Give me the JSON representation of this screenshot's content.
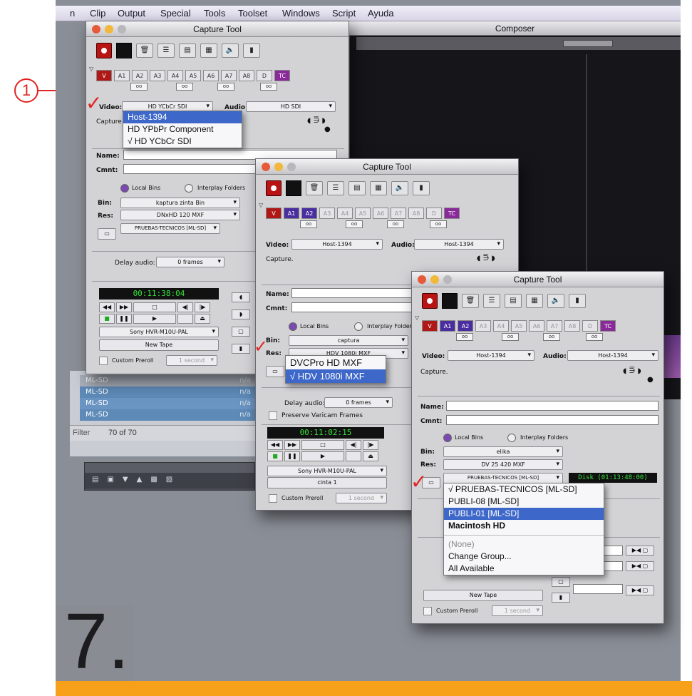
{
  "menubar": [
    "n",
    "Clip",
    "Output",
    "Special",
    "Tools",
    "Toolset",
    "Windows",
    "Script",
    "Ayuda"
  ],
  "composer": {
    "title": "Composer"
  },
  "step_number": "7.",
  "annotation_number": "1",
  "bin_list": {
    "rows": [
      {
        "name": "ML-SD",
        "value": "n/a"
      },
      {
        "name": "ML-SD",
        "value": "n/a"
      },
      {
        "name": "ML-SD",
        "value": "n/a"
      },
      {
        "name": "ML-SD",
        "value": "n/a"
      }
    ],
    "filter_label": "Filter",
    "count": "70 of 70"
  },
  "win1": {
    "title": "Capture Tool",
    "tracks": [
      "V",
      "A1",
      "A2",
      "A3",
      "A4",
      "A5",
      "A6",
      "A7",
      "A8",
      "D",
      "TC"
    ],
    "video_label": "Video:",
    "video_value": "HD YCbCr SDI",
    "audio_label": "Audio:",
    "audio_value": "HD SDI",
    "capture_text": "Capture",
    "name_label": "Name:",
    "cmnt_label": "Cmnt:",
    "local_bins": "Local Bins",
    "interplay_folders": "Interplay Folders",
    "bin_label": "Bin:",
    "bin_value": "kaptura zinta Bin",
    "res_label": "Res:",
    "res_value": "DNxHD 120 MXF",
    "target_value": "PRUEBAS-TECNICOS [ML-SD]",
    "delay_label": "Delay audio:",
    "delay_value": "0 frames",
    "timecode": "00:11:38:04",
    "deck": "Sony HVR-M10U-PAL",
    "tape": "New Tape",
    "preroll_label": "Custom Preroll",
    "preroll_value": "1 second",
    "video_menu": [
      "Host-1394",
      "HD YPbPr Component",
      "√ HD YCbCr SDI"
    ]
  },
  "win2": {
    "title": "Capture Tool",
    "tracks": [
      "V",
      "A1",
      "A2",
      "A3",
      "A4",
      "A5",
      "A6",
      "A7",
      "A8",
      "D",
      "TC"
    ],
    "video_label": "Video:",
    "video_value": "Host-1394",
    "audio_label": "Audio:",
    "audio_value": "Host-1394",
    "capture_text": "Capture.",
    "name_label": "Name:",
    "cmnt_label": "Cmnt:",
    "local_bins": "Local Bins",
    "interplay_folders": "Interplay Folders",
    "bin_label": "Bin:",
    "bin_value": "captura",
    "res_label": "Res:",
    "res_value": "HDV 1080i MXF",
    "delay_label": "Delay audio:",
    "delay_value": "0 frames",
    "varicam": "Preserve Varicam Frames",
    "timecode": "00:11:02:15",
    "deck": "Sony HVR-M10U-PAL",
    "tape": "cinta 1",
    "preroll_label": "Custom Preroll",
    "preroll_value": "1 second",
    "res_menu": [
      "DVCPro HD  MXF",
      "√ HDV 1080i  MXF"
    ]
  },
  "win3": {
    "title": "Capture Tool",
    "tracks": [
      "V",
      "A1",
      "A2",
      "A3",
      "A4",
      "A5",
      "A6",
      "A7",
      "A8",
      "D",
      "TC"
    ],
    "video_label": "Video:",
    "video_value": "Host-1394",
    "audio_label": "Audio:",
    "audio_value": "Host-1394",
    "capture_text": "Capture.",
    "name_label": "Name:",
    "cmnt_label": "Cmnt:",
    "local_bins": "Local Bins",
    "interplay_folders": "Interplay Folders",
    "bin_label": "Bin:",
    "bin_value": "elika",
    "res_label": "Res:",
    "res_value": "DV 25 420  MXF",
    "target_value": "PRUEBAS-TECNICOS [ML-SD]",
    "disk_value": "Disk (01:13:48:00)",
    "tape": "New Tape",
    "preroll_label": "Custom Preroll",
    "preroll_value": "1 second",
    "target_menu": [
      {
        "label": "√ PRUEBAS-TECNICOS [ML-SD]",
        "style": ""
      },
      {
        "label": "PUBLI-08 [ML-SD]",
        "style": ""
      },
      {
        "label": "PUBLI-01 [ML-SD]",
        "style": "hl"
      },
      {
        "label": "Macintosh HD",
        "style": "bold"
      },
      {
        "label": "(None)",
        "style": "dim"
      },
      {
        "label": "Change Group...",
        "style": ""
      },
      {
        "label": "All Available",
        "style": ""
      }
    ]
  }
}
